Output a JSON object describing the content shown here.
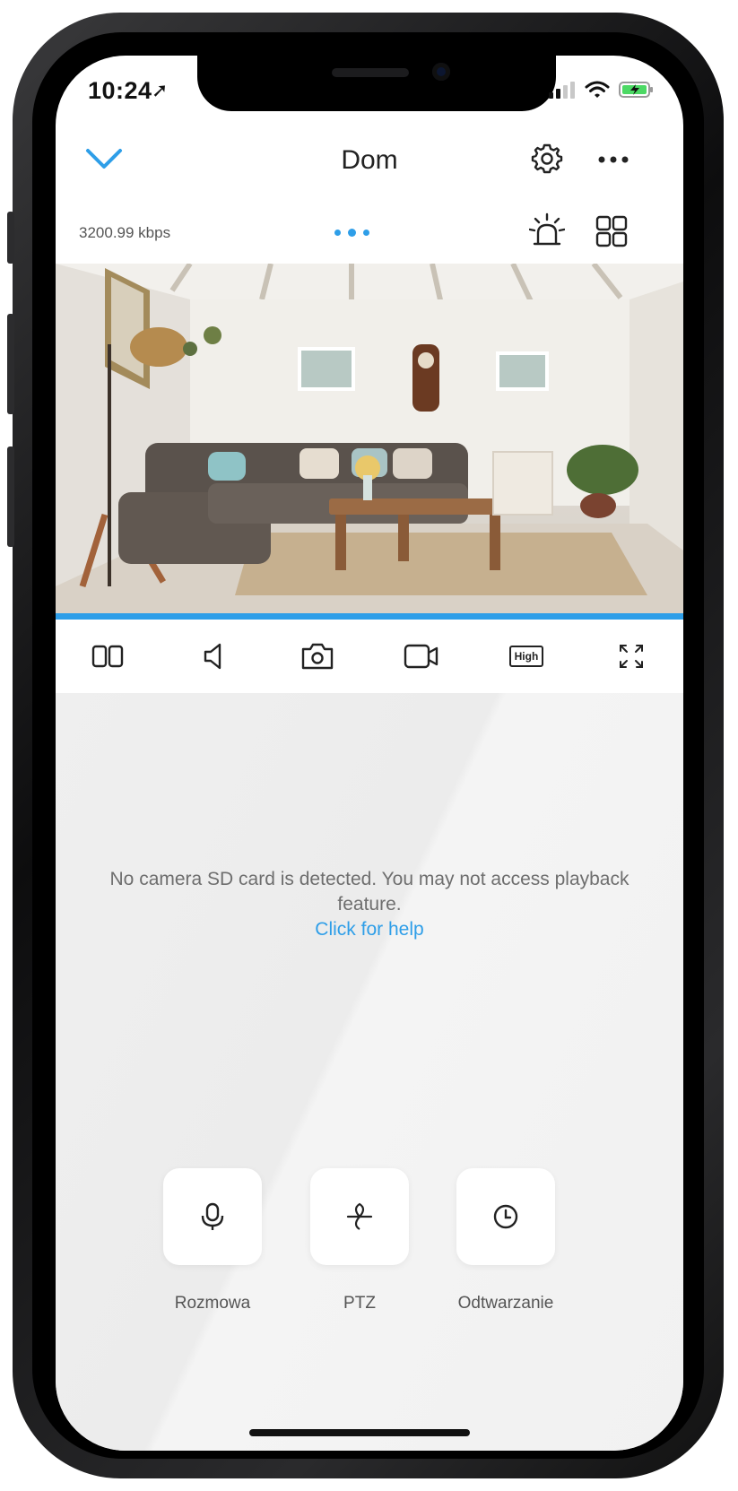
{
  "status_bar": {
    "time": "10:24",
    "location_glyph": "➚"
  },
  "header": {
    "title": "Dom"
  },
  "stream": {
    "bitrate": "3200.99 kbps"
  },
  "controls": {
    "quality_label": "High"
  },
  "sd_card": {
    "message": "No camera SD card is detected. You may not access playback feature.",
    "help_link": "Click for help"
  },
  "actions": [
    {
      "label": "Rozmowa",
      "icon": "microphone-icon"
    },
    {
      "label": "PTZ",
      "icon": "ptz-icon"
    },
    {
      "label": "Odtwarzanie",
      "icon": "clock-icon"
    }
  ],
  "colors": {
    "accent": "#2e9ee8",
    "background": "#efefef"
  }
}
